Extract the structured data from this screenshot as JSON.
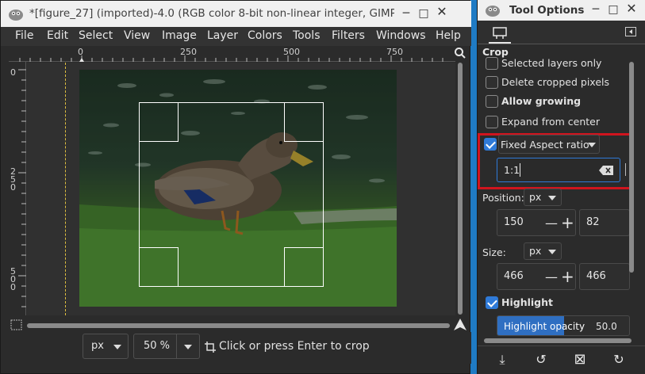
{
  "main_window": {
    "title": "*[figure_27] (imported)-4.0 (RGB color 8-bit non-linear integer, GIMP",
    "menu": [
      "File",
      "Edit",
      "Select",
      "View",
      "Image",
      "Layer",
      "Colors",
      "Tools",
      "Filters",
      "Windows",
      "Help"
    ],
    "ruler_top_labels": [
      "0",
      "250",
      "500",
      "750"
    ],
    "ruler_left_labels": [
      "0",
      "2\n5\n0",
      "5\n0\n0"
    ],
    "status": {
      "unit": "px",
      "zoom": "50 %",
      "message": "Click or press Enter to crop"
    }
  },
  "tool_options": {
    "title": "Tool Options",
    "section": "Crop",
    "options": {
      "selected_layers_only": {
        "label": "Selected layers only",
        "checked": false
      },
      "delete_cropped": {
        "label": "Delete cropped pixels",
        "checked": false
      },
      "allow_growing": {
        "label": "Allow growing",
        "checked": false
      },
      "expand_from_center": {
        "label": "Expand from center",
        "checked": false
      },
      "fixed": {
        "label": "Fixed Aspect ratio",
        "checked": true
      },
      "ratio_value": "1:1"
    },
    "position": {
      "label": "Position:",
      "unit": "px",
      "x": "150",
      "y": "82"
    },
    "size": {
      "label": "Size:",
      "unit": "px",
      "w": "466",
      "h": "466"
    },
    "highlight": {
      "label": "Highlight",
      "checked": true
    },
    "highlight_opacity": {
      "label": "Highlight opacity",
      "value": "50.0"
    }
  },
  "colors": {
    "accent": "#2f7ad8",
    "highlight_box": "#d0141e",
    "desktop": "#1f7bc4"
  }
}
